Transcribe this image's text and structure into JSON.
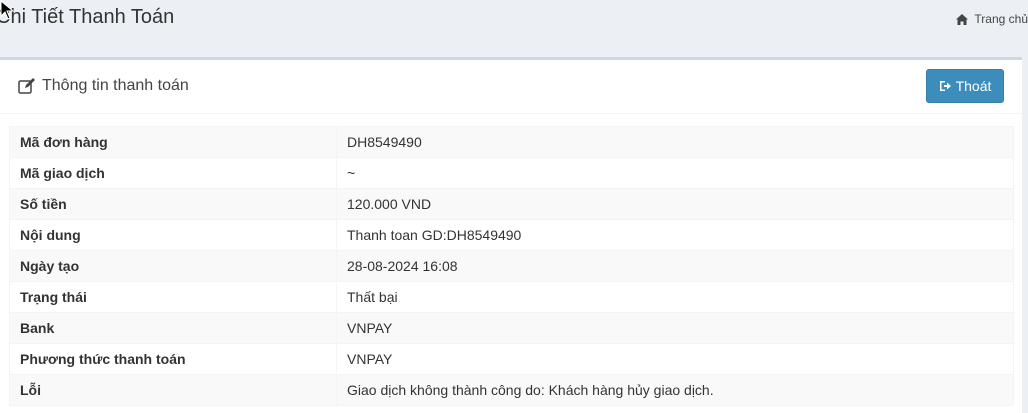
{
  "header": {
    "title": "Chi Tiết Thanh Toán",
    "breadcrumb_home": "Trang chủ"
  },
  "box": {
    "title": "Thông tin thanh toán",
    "exit_label": "Thoát"
  },
  "details": [
    {
      "label": "Mã đơn hàng",
      "value": "DH8549490"
    },
    {
      "label": "Mã giao dịch",
      "value": "~"
    },
    {
      "label": "Số tiền",
      "value": "120.000 VND"
    },
    {
      "label": "Nội dung",
      "value": "Thanh toan GD:DH8549490"
    },
    {
      "label": "Ngày tạo",
      "value": "28-08-2024 16:08"
    },
    {
      "label": "Trạng thái",
      "value": "Thất bại"
    },
    {
      "label": "Bank",
      "value": "VNPAY"
    },
    {
      "label": "Phương thức thanh toán",
      "value": "VNPAY"
    },
    {
      "label": "Lỗi",
      "value": "Giao dịch không thành công do: Khách hàng hủy giao dịch."
    }
  ],
  "icons": {
    "home": "home-icon",
    "edit": "edit-icon",
    "exit": "sign-out-icon",
    "cursor": "mouse-pointer-icon"
  },
  "colors": {
    "primary_button": "#3c8dbc",
    "background": "#ecf0f5",
    "box_border": "#d2d6de"
  }
}
